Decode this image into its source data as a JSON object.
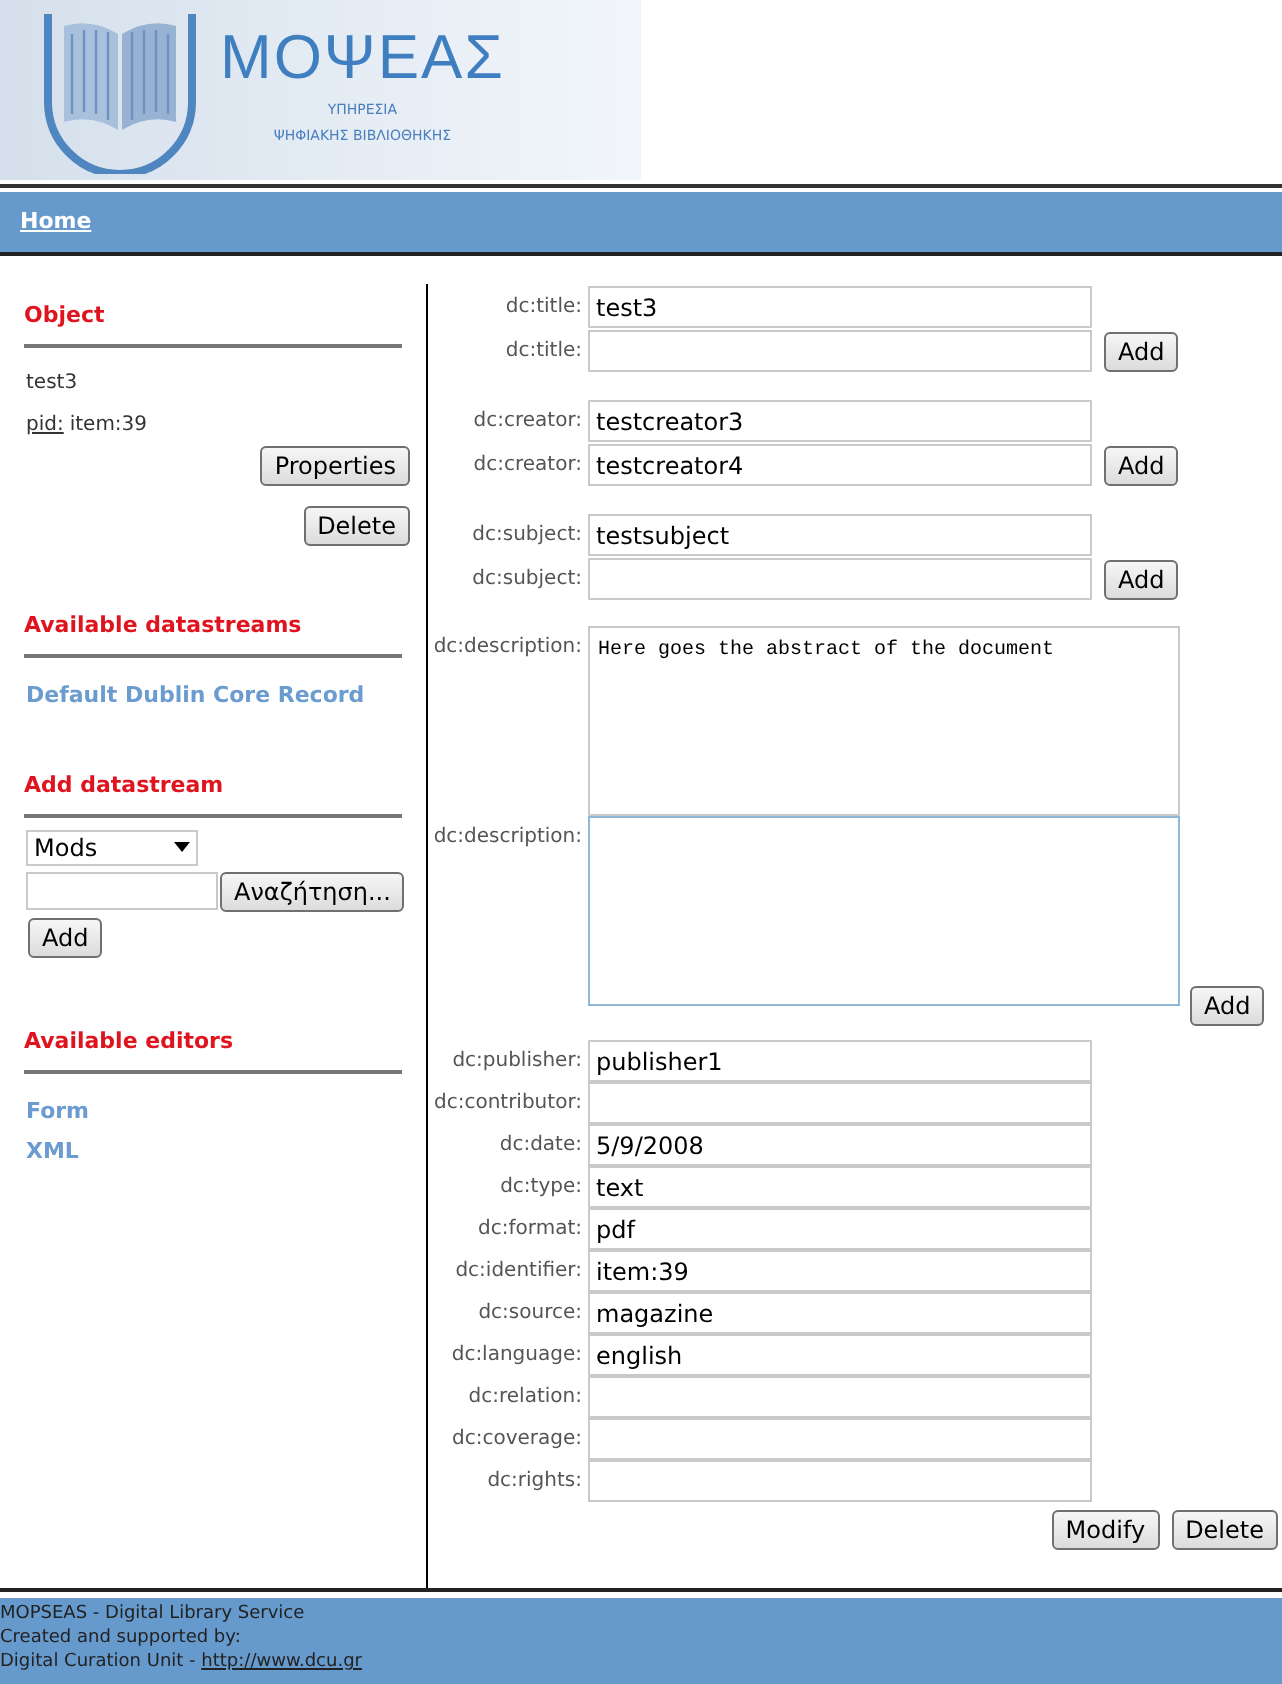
{
  "header": {
    "logo_title": "ΜΟΨΕΑΣ",
    "logo_subtitle_1": "ΥΠΗΡΕΣΙΑ",
    "logo_subtitle_2": "ΨΗΦΙΑΚΗΣ ΒΙΒΛΙΟΘΗΚΗΣ"
  },
  "nav": {
    "home": "Home"
  },
  "sidebar": {
    "object": {
      "heading": "Object",
      "title": "test3",
      "pid_label": "pid:",
      "pid_value": "item:39",
      "buttons": [
        "Properties",
        "Delete"
      ]
    },
    "datastreams": {
      "heading": "Available datastreams",
      "items": [
        "Default Dublin Core Record"
      ]
    },
    "add_datastream": {
      "heading": "Add datastream",
      "select_value": "Mods",
      "browse_button": "Αναζήτηση...",
      "add_button": "Add"
    },
    "editors": {
      "heading": "Available editors",
      "items": [
        "Form",
        "XML"
      ]
    }
  },
  "form": {
    "groups": [
      {
        "kind": "input",
        "add_button": "Add",
        "fields": [
          {
            "label": "dc:title:",
            "value": "test3"
          },
          {
            "label": "dc:title:"
          }
        ]
      },
      {
        "kind": "input",
        "add_button": "Add",
        "fields": [
          {
            "label": "dc:creator:",
            "value": "testcreator3"
          },
          {
            "label": "dc:creator:",
            "value": "testcreator4"
          }
        ]
      },
      {
        "kind": "input",
        "add_button": "Add",
        "fields": [
          {
            "label": "dc:subject:",
            "value": "testsubject"
          },
          {
            "label": "dc:subject:"
          }
        ]
      },
      {
        "kind": "textarea",
        "add_button": "Add",
        "fields": [
          {
            "label": "dc:description:",
            "value": "Here goes the abstract of the document"
          },
          {
            "label": "dc:description:"
          }
        ]
      }
    ],
    "fields": [
      {
        "label": "dc:publisher:",
        "value": "publisher1"
      },
      {
        "label": "dc:contributor:"
      },
      {
        "label": "dc:date:",
        "value": "5/9/2008"
      },
      {
        "label": "dc:type:",
        "value": "text"
      },
      {
        "label": "dc:format:",
        "value": "pdf"
      },
      {
        "label": "dc:identifier:",
        "value": "item:39"
      },
      {
        "label": "dc:source:",
        "value": "magazine"
      },
      {
        "label": "dc:language:",
        "value": "english"
      },
      {
        "label": "dc:relation:"
      },
      {
        "label": "dc:coverage:"
      },
      {
        "label": "dc:rights:"
      }
    ],
    "buttons": [
      "Modify",
      "Delete"
    ]
  },
  "footer": {
    "lines": [
      "MOPSEAS - Digital Library Service",
      "Created and supported by:"
    ],
    "credit": "Digital Curation Unit - ",
    "link": "http://www.dcu.gr"
  }
}
